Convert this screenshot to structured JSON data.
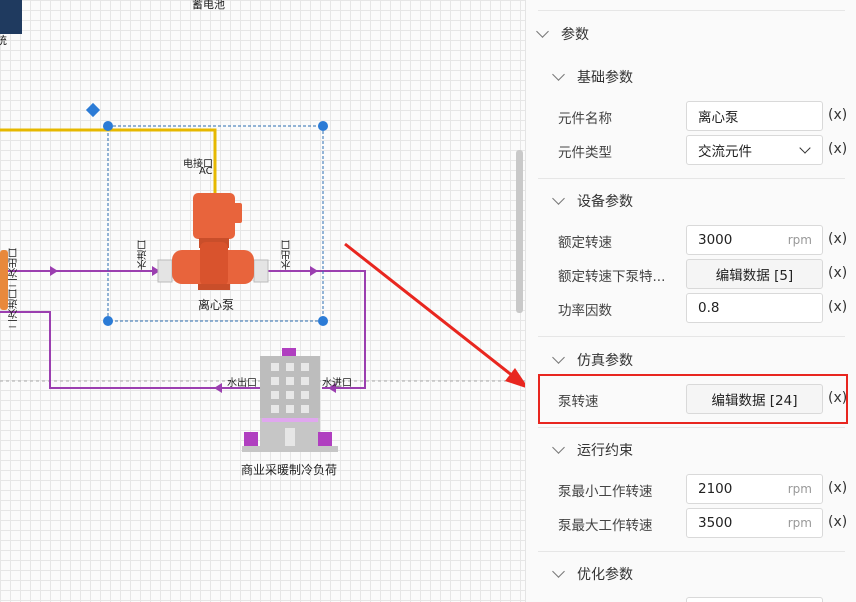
{
  "canvas": {
    "top_partial_label": "蓄电池",
    "left_partial_label": "统",
    "electric_port": "电接口",
    "electric_port_type": "AC",
    "water_in": "水进口",
    "water_out": "水出口",
    "second_out": "二次出口",
    "second_in": "二次进口",
    "pump_name": "离心泵",
    "load_water_out": "水出口",
    "load_water_in": "水进口",
    "load_name": "商业采暖制冷负荷"
  },
  "panel": {
    "root": "参数",
    "sections": {
      "basic": {
        "title": "基础参数",
        "name_label": "元件名称",
        "name_value": "离心泵",
        "type_label": "元件类型",
        "type_value": "交流元件"
      },
      "device": {
        "title": "设备参数",
        "rated_speed_label": "额定转速",
        "rated_speed_value": "3000",
        "rated_speed_unit": "rpm",
        "pump_curve_label": "额定转速下泵特...",
        "pump_curve_button": "编辑数据 [5]",
        "power_factor_label": "功率因数",
        "power_factor_value": "0.8"
      },
      "sim": {
        "title": "仿真参数",
        "speed_label": "泵转速",
        "speed_button": "编辑数据 [24]"
      },
      "constraint": {
        "title": "运行约束",
        "min_label": "泵最小工作转速",
        "min_value": "2100",
        "min_unit": "rpm",
        "max_label": "泵最大工作转速",
        "max_value": "3500",
        "max_unit": "rpm"
      },
      "opt": {
        "title": "优化参数"
      }
    },
    "expr_label": "(x)"
  },
  "colors": {
    "accent_red": "#e8261f",
    "pump_orange": "#e8643c",
    "pipe_purple": "#9b3fb0",
    "wire_yellow": "#e6b800"
  }
}
